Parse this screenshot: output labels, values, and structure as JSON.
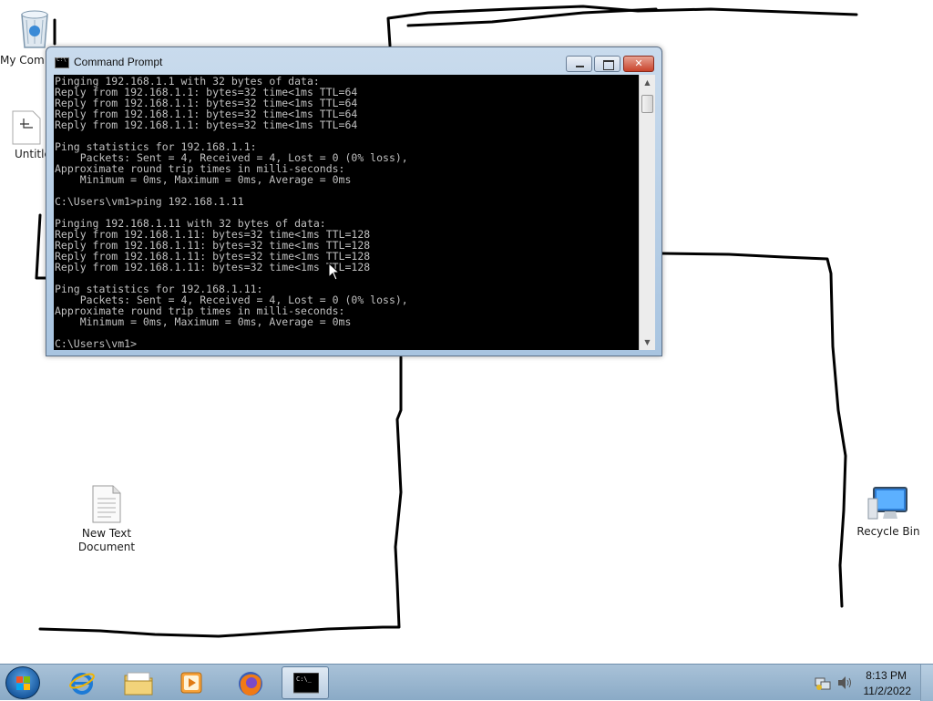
{
  "desktop": {
    "icons": [
      {
        "label": "My Com",
        "icon": "recycle-bin-full-icon"
      },
      {
        "label": "Untitle",
        "icon": "document-icon"
      },
      {
        "label": "New Text\nDocument",
        "icon": "text-file-icon"
      },
      {
        "label": "Recycle Bin",
        "icon": "computer-monitor-icon"
      }
    ]
  },
  "cmd": {
    "title": "Command Prompt",
    "lines": [
      "Pinging 192.168.1.1 with 32 bytes of data:",
      "Reply from 192.168.1.1: bytes=32 time<1ms TTL=64",
      "Reply from 192.168.1.1: bytes=32 time<1ms TTL=64",
      "Reply from 192.168.1.1: bytes=32 time<1ms TTL=64",
      "Reply from 192.168.1.1: bytes=32 time<1ms TTL=64",
      "",
      "Ping statistics for 192.168.1.1:",
      "    Packets: Sent = 4, Received = 4, Lost = 0 (0% loss),",
      "Approximate round trip times in milli-seconds:",
      "    Minimum = 0ms, Maximum = 0ms, Average = 0ms",
      "",
      "C:\\Users\\vm1>ping 192.168.1.11",
      "",
      "Pinging 192.168.1.11 with 32 bytes of data:",
      "Reply from 192.168.1.11: bytes=32 time<1ms TTL=128",
      "Reply from 192.168.1.11: bytes=32 time<1ms TTL=128",
      "Reply from 192.168.1.11: bytes=32 time<1ms TTL=128",
      "Reply from 192.168.1.11: bytes=32 time<1ms TTL=128",
      "",
      "Ping statistics for 192.168.1.11:",
      "    Packets: Sent = 4, Received = 4, Lost = 0 (0% loss),",
      "Approximate round trip times in milli-seconds:",
      "    Minimum = 0ms, Maximum = 0ms, Average = 0ms",
      "",
      "C:\\Users\\vm1>"
    ]
  },
  "taskbar": {
    "items": [
      {
        "icon": "internet-explorer-icon"
      },
      {
        "icon": "file-explorer-icon"
      },
      {
        "icon": "media-player-icon"
      },
      {
        "icon": "firefox-icon"
      },
      {
        "icon": "command-prompt-icon",
        "active": true
      }
    ],
    "clock": {
      "time": "8:13 PM",
      "date": "11/2/2022"
    }
  },
  "colors": {
    "console_bg": "#000000",
    "console_text": "#c0c0c0",
    "taskbar": "#9cb7d0",
    "close_button": "#c8432b"
  }
}
